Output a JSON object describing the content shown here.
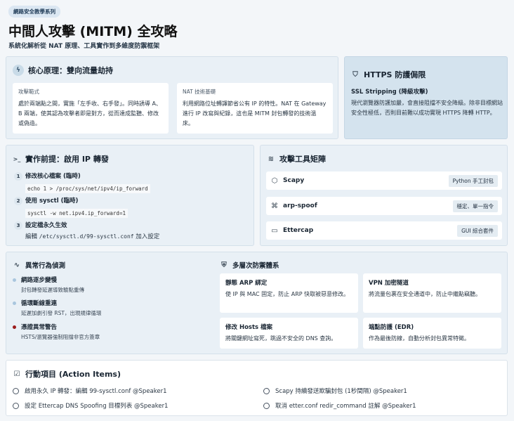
{
  "header": {
    "tag": "網路安全教學系列",
    "title": "中間人攻擊 (MITM) 全攻略",
    "subtitle": "系統化解析從 NAT 原理、工具實作到多維度防禦框架"
  },
  "principle": {
    "title": "核心原理：雙向流量劫持",
    "icon": "lightning-icon",
    "attack": {
      "label": "攻擊範式",
      "text": "處於兩端點之間，實施「左手收、右手發」。同時誘導 A、B 兩端，使其認為攻擊者即是對方，從而達成監聽、修改或偽造。"
    },
    "nat": {
      "label": "NAT 技術基礎",
      "text": "利用網路位址轉譯節省公有 IP 的特性。NAT 在 Gateway 進行 IP 改寫與紀錄，這也是 MITM 封包轉發的技術溫床。"
    }
  },
  "https": {
    "title": "HTTPS 防護侷限",
    "icon": "shield-icon",
    "subtitle": "SSL Stripping (降級攻擊)",
    "text": "現代瀏覽器防護加嚴，會直接阻擋不安全降級。除非目標網站安全性極低，否則目前難以成功實現 HTTPS 降轉 HTTP。"
  },
  "prereq": {
    "title": "實作前提：啟用 IP 轉發",
    "icon": "terminal-icon",
    "steps": [
      {
        "num": "1",
        "title": "修改核心檔案 (臨時)",
        "code": "echo 1 > /proc/sys/net/ipv4/ip_forward"
      },
      {
        "num": "2",
        "title": "使用 sysctl (臨時)",
        "code": "sysctl -w net.ipv4.ip_forward=1"
      },
      {
        "num": "3",
        "title": "設定檔永久生效",
        "text_prefix": "編輯",
        "path": "/etc/sysctl.d/99-sysctl.conf",
        "text_suffix": "加入設定"
      }
    ]
  },
  "tools": {
    "title": "攻擊工具矩陣",
    "icon": "layers-icon",
    "items": [
      {
        "name": "Scapy",
        "icon": "cube-icon",
        "badge": "Python 手工封包"
      },
      {
        "name": "arp-spoof",
        "icon": "command-icon",
        "badge": "穩定、單一指令"
      },
      {
        "name": "Ettercap",
        "icon": "monitor-icon",
        "badge": "GUI 綜合套件"
      }
    ]
  },
  "detection": {
    "title": "異常行為偵測",
    "icon": "pulse-icon",
    "items": [
      {
        "title": "網路逐步變慢",
        "text": "封包轉發延遲導致驗點重傳",
        "color": "#a9c6de"
      },
      {
        "title": "循環斷線重連",
        "text": "延遲加劇引發 RST，出現規律循環",
        "color": "#a9c6de"
      },
      {
        "title": "憑證異常警告",
        "text": "HSTS/瀏覽器強制阻擋非官方簽章",
        "color": "#9b1c1c"
      }
    ]
  },
  "defense": {
    "title": "多層次防禦體系",
    "icon": "shield-check-icon",
    "items": [
      {
        "title": "靜態 ARP 綁定",
        "text": "使 IP 與 MAC 固定，防止 ARP 快取被惡意修改。"
      },
      {
        "title": "VPN 加密隧道",
        "text": "將流量包裹在安全通道中，防止中繼點竊聽。"
      },
      {
        "title": "修改 Hosts 檔案",
        "text": "將關鍵網址寫死，跳過不安全的 DNS 查詢。"
      },
      {
        "title": "端點防護 (EDR)",
        "text": "作為最後防線，自動分析封包異常特徵。"
      }
    ]
  },
  "actions": {
    "title": "行動項目 (Action Items)",
    "icon": "checkbox-icon",
    "items": [
      "啟用永久 IP 轉發：編輯 99-sysctl.conf @Speaker1",
      "Scapy 持續發送欺騙封包 (1秒間隔) @Speaker1",
      "設定 Ettercap DNS Spoofing 目標列表 @Speaker1",
      "取消 etter.conf redir_command 註解 @Speaker1"
    ]
  }
}
